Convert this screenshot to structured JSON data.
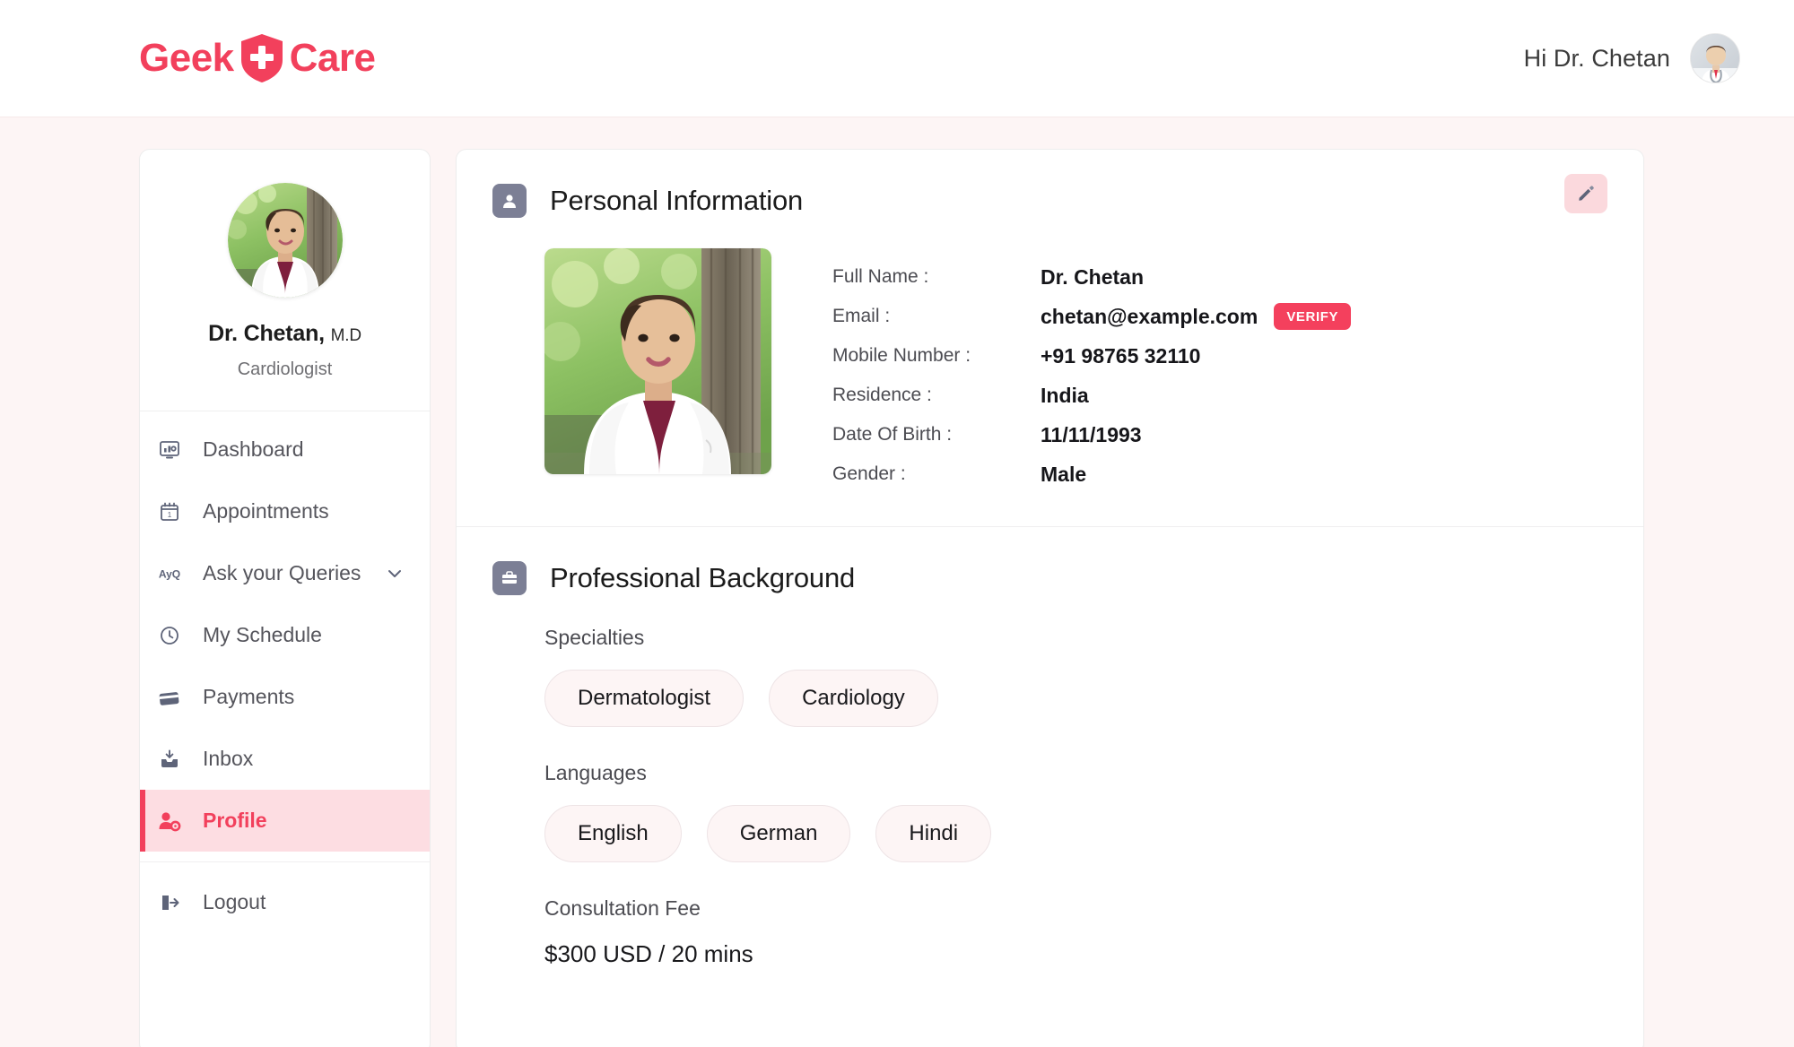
{
  "brand": {
    "name_left": "Geek",
    "name_right": "Care",
    "logo_icon": "shield-plus-icon",
    "color": "#f2405c"
  },
  "header": {
    "greeting": "Hi Dr. Chetan",
    "avatar_icon": "user-avatar-photo"
  },
  "sidebar": {
    "doctor_name": "Dr. Chetan,",
    "doctor_suffix": "M.D",
    "specialty": "Cardiologist",
    "avatar_icon": "doctor-photo",
    "items": [
      {
        "label": "Dashboard",
        "icon": "dashboard-icon",
        "active": false,
        "expandable": false
      },
      {
        "label": "Appointments",
        "icon": "calendar-icon",
        "active": false,
        "expandable": false
      },
      {
        "label": "Ask your Queries",
        "icon": "ayq-icon",
        "active": false,
        "expandable": true
      },
      {
        "label": "My Schedule",
        "icon": "clock-icon",
        "active": false,
        "expandable": false
      },
      {
        "label": "Payments",
        "icon": "credit-card-icon",
        "active": false,
        "expandable": false
      },
      {
        "label": "Inbox",
        "icon": "inbox-icon",
        "active": false,
        "expandable": false
      },
      {
        "label": "Profile",
        "icon": "user-gear-icon",
        "active": true,
        "expandable": false
      }
    ],
    "logout": {
      "label": "Logout",
      "icon": "logout-icon"
    },
    "active_bg": "#fdddE2",
    "active_color": "#f2405c"
  },
  "personal": {
    "title": "Personal Information",
    "icon": "person-badge-icon",
    "edit_icon": "pencil-icon",
    "photo_icon": "doctor-photo",
    "fields": [
      {
        "label": "Full Name :",
        "value": "Dr. Chetan",
        "badge": null
      },
      {
        "label": "Email :",
        "value": "chetan@example.com",
        "badge": "VERIFY"
      },
      {
        "label": "Mobile Number :",
        "value": "+91   98765 32110",
        "badge": null
      },
      {
        "label": "Residence :",
        "value": "India",
        "badge": null
      },
      {
        "label": "Date Of Birth :",
        "value": "11/11/1993",
        "badge": null
      },
      {
        "label": "Gender :",
        "value": "Male",
        "badge": null
      }
    ]
  },
  "professional": {
    "title": "Professional Background",
    "icon": "briefcase-icon",
    "specialties_label": "Specialties",
    "specialties": [
      "Dermatologist",
      "Cardiology"
    ],
    "languages_label": "Languages",
    "languages": [
      "English",
      "German",
      "Hindi"
    ],
    "fee_label": "Consultation Fee",
    "fee_value": "$300 USD / 20 mins"
  },
  "colors": {
    "accent": "#f2405c",
    "page_bg": "#fdf5f5",
    "card_bg": "#ffffff",
    "chip_bg": "#fdf5f5",
    "section_icon_bg": "#7c7f95"
  }
}
